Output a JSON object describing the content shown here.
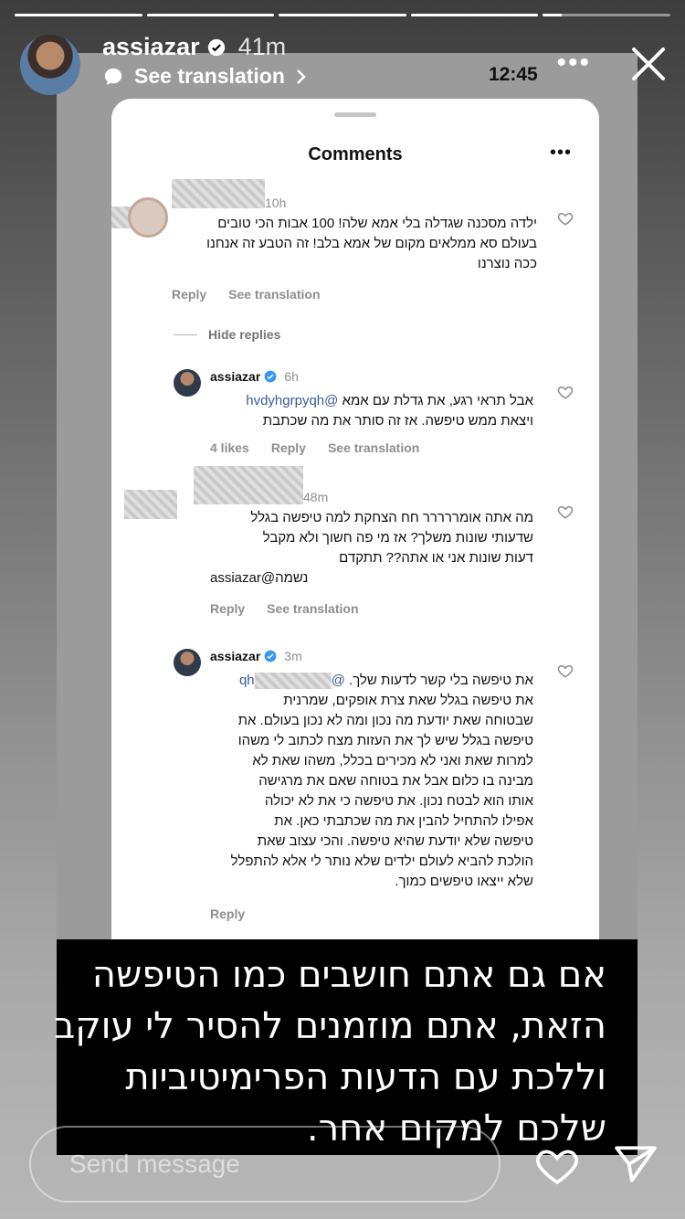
{
  "story": {
    "progress": [
      1,
      1,
      1,
      1,
      0.15
    ],
    "username": "assiazar",
    "time": "41m",
    "see_translation": "See translation",
    "colors": {
      "verified": "#3897f0",
      "bg_top": "#3d3d3d",
      "overlay": "#000000"
    }
  },
  "screenshot": {
    "clock": "12:45",
    "sheet_title": "Comments",
    "more": "•••",
    "hide_replies": "Hide replies",
    "comments": [
      {
        "time": "10h",
        "lines": [
          "ילדה מסכנה שגדלה בלי אמא שלה! 100 אבות הכי טובים",
          "בעולם סא ממלאים מקום של אמא בלב! זה הטבע זה אנחנו",
          "ככה נוצרנו"
        ],
        "reply": "Reply",
        "see_translation": "See translation"
      },
      {
        "username": "assiazar",
        "time": "6h",
        "mention": "@hvdyhgrpyqh",
        "lines": [
          "אבל תראי רגע, את גדלת עם אמא",
          "ויצאת ממש טיפשה. אז זה סותר את מה שכתבת"
        ],
        "likes": "4 likes",
        "reply": "Reply",
        "see_translation": "See translation"
      },
      {
        "time": "48m",
        "lines": [
          "מה אתה אומררררר חח הצחקת למה טיפשה בגלל",
          "שדעותי שונות משלך? אז מי פה חשוך ולא מקבל",
          "דעות שונות אני או אתה?? תתקדם",
          "assiazar@נשמה"
        ],
        "reply": "Reply",
        "see_translation": "See translation"
      },
      {
        "username": "assiazar",
        "time": "3m",
        "mention": "qh",
        "lines": [
          "את טיפשה בלי קשר לדעות שלך.",
          "את טיפשה בגלל שאת צרת אופקים, שמרנית",
          "שבטוחה שאת יודעת מה נכון ומה לא נכון בעולם. את",
          "טיפשה בגלל שיש לך את העזות מצח לכתוב לי משהו",
          "למרות שאת ואני לא מכירים בכלל, משהו שאת לא",
          "מבינה בו כלום אבל את בטוחה שאם את מרגישה",
          "אותו הוא לבטח נכון. את טיפשה כי את לא יכולה",
          "אפילו להתחיל להבין את מה שכתבתי כאן. את",
          "טיפשה שלא יודעת שהיא טיפשה. והכי עצוב שאת",
          "הולכת להביא לעולם ילדים שלא נותר לי אלא להתפלל",
          "שלא ייצאו טיפשים כמוך."
        ],
        "reply": "Reply"
      }
    ]
  },
  "overlay": {
    "lines": [
      "אם גם אתם חושבים כמו הטיפשה",
      "הזאת, אתם מוזמנים להסיר לי עוקב",
      "וללכת עם הדעות הפרימיטיביות",
      "שלכם למקום אחר."
    ]
  },
  "footer": {
    "send_placeholder": "Send message",
    "icons": [
      "heart-icon",
      "send-icon"
    ]
  }
}
